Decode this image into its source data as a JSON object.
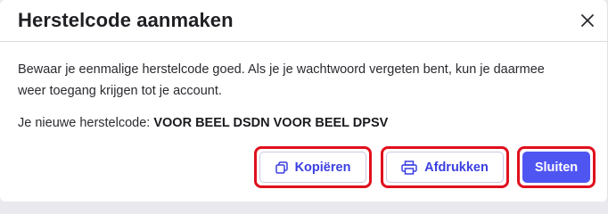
{
  "dialog": {
    "title": "Herstelcode aanmaken",
    "description": "Bewaar je eenmalige herstelcode goed. Als je je wachtwoord vergeten bent, kun je daarmee weer toegang krijgen tot je account.",
    "code_label": "Je nieuwe herstelcode:",
    "code_value": "VOOR BEEL DSDN VOOR BEEL DPSV"
  },
  "buttons": {
    "copy_label": "Kopiëren",
    "print_label": "Afdrukken",
    "close_label": "Sluiten"
  },
  "icons": {
    "close": "close-icon",
    "copy": "copy-icon",
    "print": "printer-icon"
  },
  "colors": {
    "accent": "#4f55f1",
    "accent_text": "#3b3fe0",
    "highlight_outline": "#e0101e"
  }
}
